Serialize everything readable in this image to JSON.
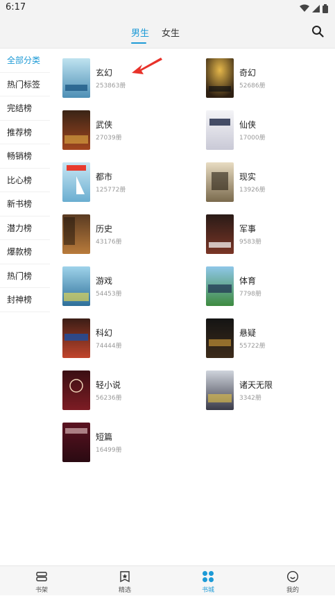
{
  "status_bar": {
    "time": "6:17"
  },
  "header": {
    "tabs": [
      {
        "label": "男生",
        "active": true
      },
      {
        "label": "女生",
        "active": false
      }
    ]
  },
  "sidebar": {
    "items": [
      {
        "label": "全部分类",
        "active": true
      },
      {
        "label": "热门标签"
      },
      {
        "label": "完结榜"
      },
      {
        "label": "推荐榜"
      },
      {
        "label": "畅销榜"
      },
      {
        "label": "比心榜"
      },
      {
        "label": "新书榜"
      },
      {
        "label": "潜力榜"
      },
      {
        "label": "爆款榜"
      },
      {
        "label": "热门榜"
      },
      {
        "label": "封神榜"
      }
    ]
  },
  "categories": [
    {
      "name": "玄幻",
      "count": "253863册"
    },
    {
      "name": "奇幻",
      "count": "52686册"
    },
    {
      "name": "武侠",
      "count": "27039册"
    },
    {
      "name": "仙侠",
      "count": "17000册"
    },
    {
      "name": "都市",
      "count": "125772册"
    },
    {
      "name": "现实",
      "count": "13926册"
    },
    {
      "name": "历史",
      "count": "43176册"
    },
    {
      "name": "军事",
      "count": "9583册"
    },
    {
      "name": "游戏",
      "count": "54453册"
    },
    {
      "name": "体育",
      "count": "7798册"
    },
    {
      "name": "科幻",
      "count": "74444册"
    },
    {
      "name": "悬疑",
      "count": "55722册"
    },
    {
      "name": "轻小说",
      "count": "56236册"
    },
    {
      "name": "诸天无限",
      "count": "3342册"
    },
    {
      "name": "短篇",
      "count": "16499册"
    }
  ],
  "bottom_nav": {
    "items": [
      {
        "label": "书架",
        "icon": "bookshelf-icon"
      },
      {
        "label": "精选",
        "icon": "featured-star-icon"
      },
      {
        "label": "书城",
        "icon": "bookstore-grid-icon",
        "active": true
      },
      {
        "label": "我的",
        "icon": "profile-smile-icon"
      }
    ]
  },
  "colors": {
    "accent": "#1d9ad6",
    "arrow": "#e8322a"
  }
}
